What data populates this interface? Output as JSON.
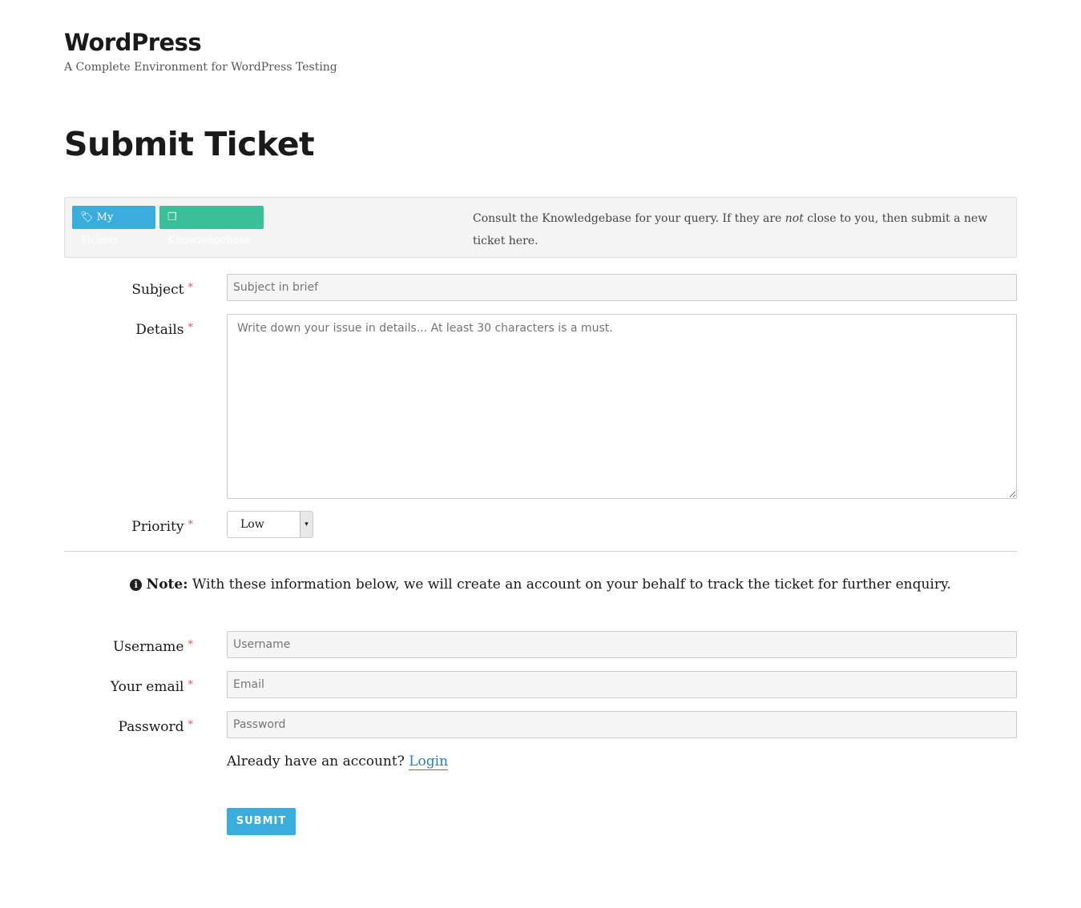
{
  "site": {
    "title": "WordPress",
    "tagline": "A Complete Environment for WordPress Testing"
  },
  "page_title": "Submit Ticket",
  "panel": {
    "my_tickets": "My Tickets",
    "knowledgebase": "Knowledgebase",
    "text_before": "Consult the Knowledgebase for your query. If they are ",
    "text_em": "not",
    "text_after": " close to you, then submit a new ticket here.",
    "my_tickets_color": "#3aaddc",
    "knowledgebase_color": "#3bbf98"
  },
  "form": {
    "required_mark": "*",
    "subject": {
      "label": "Subject",
      "placeholder": "Subject in brief"
    },
    "details": {
      "label": "Details",
      "placeholder": "Write down your issue in details... At least 30 characters is a must."
    },
    "priority": {
      "label": "Priority",
      "value": "Low"
    },
    "note": {
      "bold": "Note:",
      "text": " With these information below, we will create an account on your behalf to track the ticket for further enquiry."
    },
    "username": {
      "label": "Username",
      "placeholder": "Username"
    },
    "email": {
      "label": "Your email",
      "placeholder": "Email"
    },
    "password": {
      "label": "Password",
      "placeholder": "Password"
    },
    "login_prompt": "Already have an account?",
    "login_link": "Login",
    "submit": "SUBMIT"
  }
}
